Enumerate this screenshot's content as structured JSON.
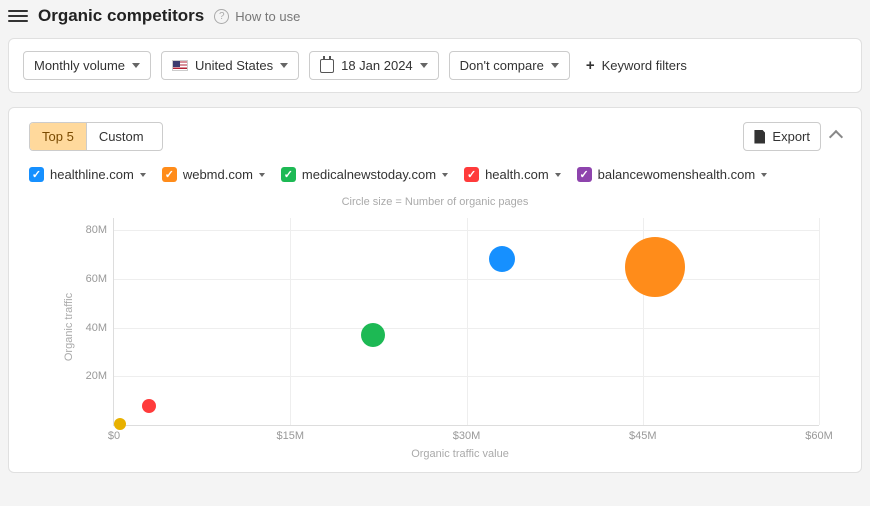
{
  "header": {
    "title": "Organic competitors",
    "how_to_use": "How to use"
  },
  "toolbar": {
    "volume": "Monthly volume",
    "country": "United States",
    "date": "18 Jan 2024",
    "compare": "Don't compare",
    "filters": "Keyword filters"
  },
  "segments": {
    "top5": "Top 5",
    "custom": "Custom"
  },
  "export_label": "Export",
  "legend": [
    {
      "domain": "healthline.com",
      "color": "#1690ff"
    },
    {
      "domain": "webmd.com",
      "color": "#ff8c1a"
    },
    {
      "domain": "medicalnewstoday.com",
      "color": "#1db954"
    },
    {
      "domain": "health.com",
      "color": "#ff3b3b"
    },
    {
      "domain": "balancewomenshealth.com",
      "color": "#8e44ad"
    }
  ],
  "chart_data": {
    "type": "scatter",
    "title": "Circle size = Number of organic pages",
    "xlabel": "Organic traffic value",
    "ylabel": "Organic traffic",
    "xlim": [
      0,
      60
    ],
    "ylim": [
      0,
      85
    ],
    "xticks": [
      0,
      15,
      30,
      45,
      60
    ],
    "xtick_labels": [
      "$0",
      "$15M",
      "$30M",
      "$45M",
      "$60M"
    ],
    "yticks": [
      20,
      40,
      60,
      80
    ],
    "ytick_labels": [
      "20M",
      "40M",
      "60M",
      "80M"
    ],
    "series": [
      {
        "name": "healthline.com",
        "x": 33,
        "y": 68,
        "size": 26,
        "color": "#1690ff"
      },
      {
        "name": "webmd.com",
        "x": 46,
        "y": 65,
        "size": 60,
        "color": "#ff8c1a"
      },
      {
        "name": "medicalnewstoday.com",
        "x": 22,
        "y": 37,
        "size": 24,
        "color": "#1db954"
      },
      {
        "name": "health.com",
        "x": 3,
        "y": 8,
        "size": 14,
        "color": "#ff3b3b"
      },
      {
        "name": "balancewomenshealth.com",
        "x": 0.5,
        "y": 0.5,
        "size": 12,
        "color": "#e8b100"
      }
    ]
  }
}
